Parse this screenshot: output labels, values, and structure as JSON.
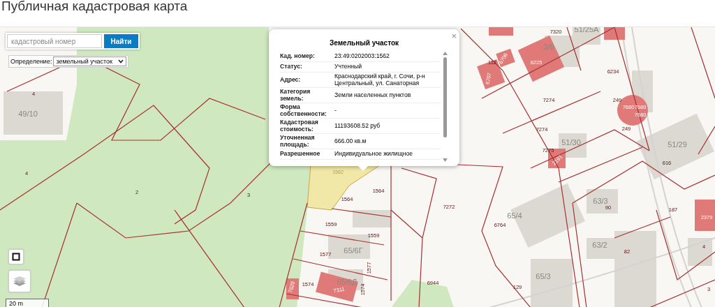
{
  "page": {
    "title": "Публичная кадастровая карта"
  },
  "search": {
    "placeholder": "кадастровый номер",
    "button": "Найти"
  },
  "definition": {
    "label": "Определение:",
    "value": "земельный участок"
  },
  "popup": {
    "title": "Земельный участок",
    "close": "×",
    "rows": [
      {
        "label": "Кад. номер:",
        "value": "23:49:0202003:1562"
      },
      {
        "label": "Статус:",
        "value": "Учтенный"
      },
      {
        "label": "Адрес:",
        "value": "Краснодарский край, г. Сочи, р-н Центральный, ул. Санаторная"
      },
      {
        "label": "Категория земель:",
        "value": "Земли населенных пунктов"
      },
      {
        "label": "Форма собственности:",
        "value": "-"
      },
      {
        "label": "Кадастровая стоимость:",
        "value": "11193608.52 руб"
      },
      {
        "label": "Уточненная площадь:",
        "value": "666.00 кв.м"
      },
      {
        "label": "Разрешенное",
        "value": "Индивидуальное жилищное"
      }
    ]
  },
  "scale": "20 m",
  "map_labels": [
    {
      "text": "4",
      "kind": "parcel"
    },
    {
      "text": "49/10",
      "kind": "building"
    },
    {
      "text": "4",
      "kind": "parcel"
    },
    {
      "text": "2",
      "kind": "parcel"
    },
    {
      "text": "3",
      "kind": "parcel"
    },
    {
      "text": "1562",
      "kind": "selected"
    },
    {
      "text": "1564",
      "kind": "parcel"
    },
    {
      "text": "1564",
      "kind": "parcel"
    },
    {
      "text": "1559",
      "kind": "parcel"
    },
    {
      "text": "1559",
      "kind": "parcel"
    },
    {
      "text": "1577",
      "kind": "parcel"
    },
    {
      "text": "65/6Г",
      "kind": "building"
    },
    {
      "text": "1577",
      "kind": "parcel"
    },
    {
      "text": "7629",
      "kind": "structure"
    },
    {
      "text": "1574",
      "kind": "parcel"
    },
    {
      "text": "65/6Д",
      "kind": "building"
    },
    {
      "text": "7311",
      "kind": "structure"
    },
    {
      "text": "1574",
      "kind": "parcel"
    },
    {
      "text": "6944",
      "kind": "parcel"
    },
    {
      "text": "7272",
      "kind": "parcel"
    },
    {
      "text": "6764",
      "kind": "parcel"
    },
    {
      "text": "65/4",
      "kind": "building"
    },
    {
      "text": "65/3",
      "kind": "building"
    },
    {
      "text": "129",
      "kind": "parcel"
    },
    {
      "text": "7320",
      "kind": "parcel"
    },
    {
      "text": "51/25А",
      "kind": "building"
    },
    {
      "text": "112",
      "kind": "parcel"
    },
    {
      "text": "6706",
      "kind": "structure"
    },
    {
      "text": "6707",
      "kind": "structure"
    },
    {
      "text": "6225",
      "kind": "structure"
    },
    {
      "text": "3/6",
      "kind": "building"
    },
    {
      "text": "6234",
      "kind": "parcel"
    },
    {
      "text": "7274",
      "kind": "parcel"
    },
    {
      "text": "7274",
      "kind": "parcel"
    },
    {
      "text": "249",
      "kind": "parcel"
    },
    {
      "text": "7680",
      "kind": "structure"
    },
    {
      "text": "7680",
      "kind": "structure"
    },
    {
      "text": "7680",
      "kind": "structure"
    },
    {
      "text": "249",
      "kind": "parcel"
    },
    {
      "text": "51/30",
      "kind": "building"
    },
    {
      "text": "7275",
      "kind": "parcel"
    },
    {
      "text": "2191",
      "kind": "structure"
    },
    {
      "text": "51/29",
      "kind": "building"
    },
    {
      "text": "616",
      "kind": "parcel"
    },
    {
      "text": "63/3",
      "kind": "building"
    },
    {
      "text": "90",
      "kind": "parcel"
    },
    {
      "text": "63/2",
      "kind": "building"
    },
    {
      "text": "82",
      "kind": "parcel"
    },
    {
      "text": "187",
      "kind": "parcel"
    },
    {
      "text": "2379",
      "kind": "structure"
    },
    {
      "text": "4",
      "kind": "parcel"
    },
    {
      "text": "3",
      "kind": "parcel"
    }
  ]
}
